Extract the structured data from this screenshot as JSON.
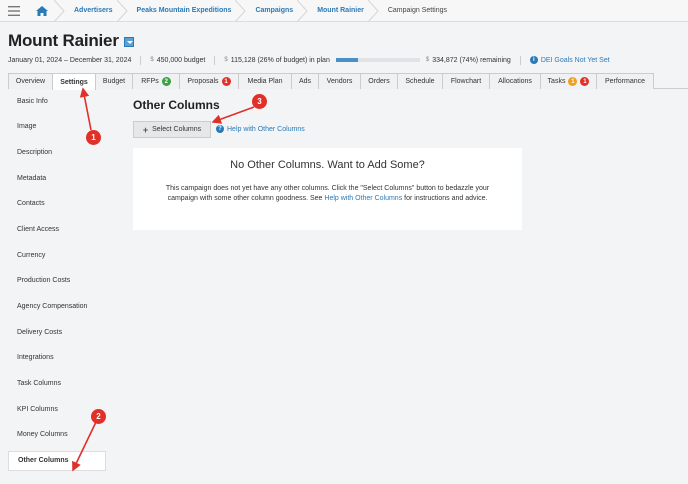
{
  "breadcrumb": {
    "items": [
      {
        "label": "Advertisers"
      },
      {
        "label": "Peaks Mountain Expeditions"
      },
      {
        "label": "Campaigns"
      },
      {
        "label": "Mount Rainier"
      },
      {
        "label": "Campaign Settings"
      }
    ]
  },
  "campaign": {
    "title": "Mount Rainier",
    "dates": "January 01, 2024 – December 31, 2024",
    "budget": "450,000 budget",
    "in_plan": "115,128 (26% of budget) in plan",
    "in_plan_fraction": 0.26,
    "remaining": "334,872 (74%) remaining",
    "dei_link": "DEI Goals Not Yet Set",
    "currency_symbol": "$"
  },
  "tabs": [
    {
      "label": "Overview"
    },
    {
      "label": "Settings"
    },
    {
      "label": "Budget"
    },
    {
      "label": "RFPs",
      "badge": "2",
      "badge_color": "#3aa040"
    },
    {
      "label": "Proposals",
      "badge": "1",
      "badge_color": "#e0302a"
    },
    {
      "label": "Media Plan"
    },
    {
      "label": "Ads"
    },
    {
      "label": "Vendors"
    },
    {
      "label": "Orders"
    },
    {
      "label": "Schedule"
    },
    {
      "label": "Flowchart"
    },
    {
      "label": "Allocations"
    },
    {
      "label": "Tasks",
      "badge": "1",
      "badge_color": "#f0a020",
      "badge2": "1",
      "badge2_color": "#e0302a"
    },
    {
      "label": "Performance"
    }
  ],
  "sidebar": {
    "items": [
      {
        "label": "Basic Info"
      },
      {
        "label": "Image"
      },
      {
        "label": "Description"
      },
      {
        "label": "Metadata"
      },
      {
        "label": "Contacts"
      },
      {
        "label": "Client Access"
      },
      {
        "label": "Currency"
      },
      {
        "label": "Production Costs"
      },
      {
        "label": "Agency Compensation"
      },
      {
        "label": "Delivery Costs"
      },
      {
        "label": "Integrations"
      },
      {
        "label": "Task Columns"
      },
      {
        "label": "KPI Columns"
      },
      {
        "label": "Money Columns"
      },
      {
        "label": "Other Columns"
      }
    ]
  },
  "main": {
    "title": "Other Columns",
    "select_button": "Select Columns",
    "help_link": "Help with Other Columns",
    "empty": {
      "heading": "No Other Columns. Want to Add Some?",
      "text_before": "This campaign does not yet have any other columns. Click the \"Select Columns\" button to bedazzle your campaign with some other column goodness. See",
      "link": "Help with Other Columns",
      "text_after": "for instructions and advice."
    }
  },
  "annotations": {
    "markers": [
      {
        "label": "1"
      },
      {
        "label": "2"
      },
      {
        "label": "3"
      }
    ],
    "color": "#e0302a"
  },
  "colors": {
    "accent": "#2a7ab8",
    "marker": "#e0302a"
  }
}
